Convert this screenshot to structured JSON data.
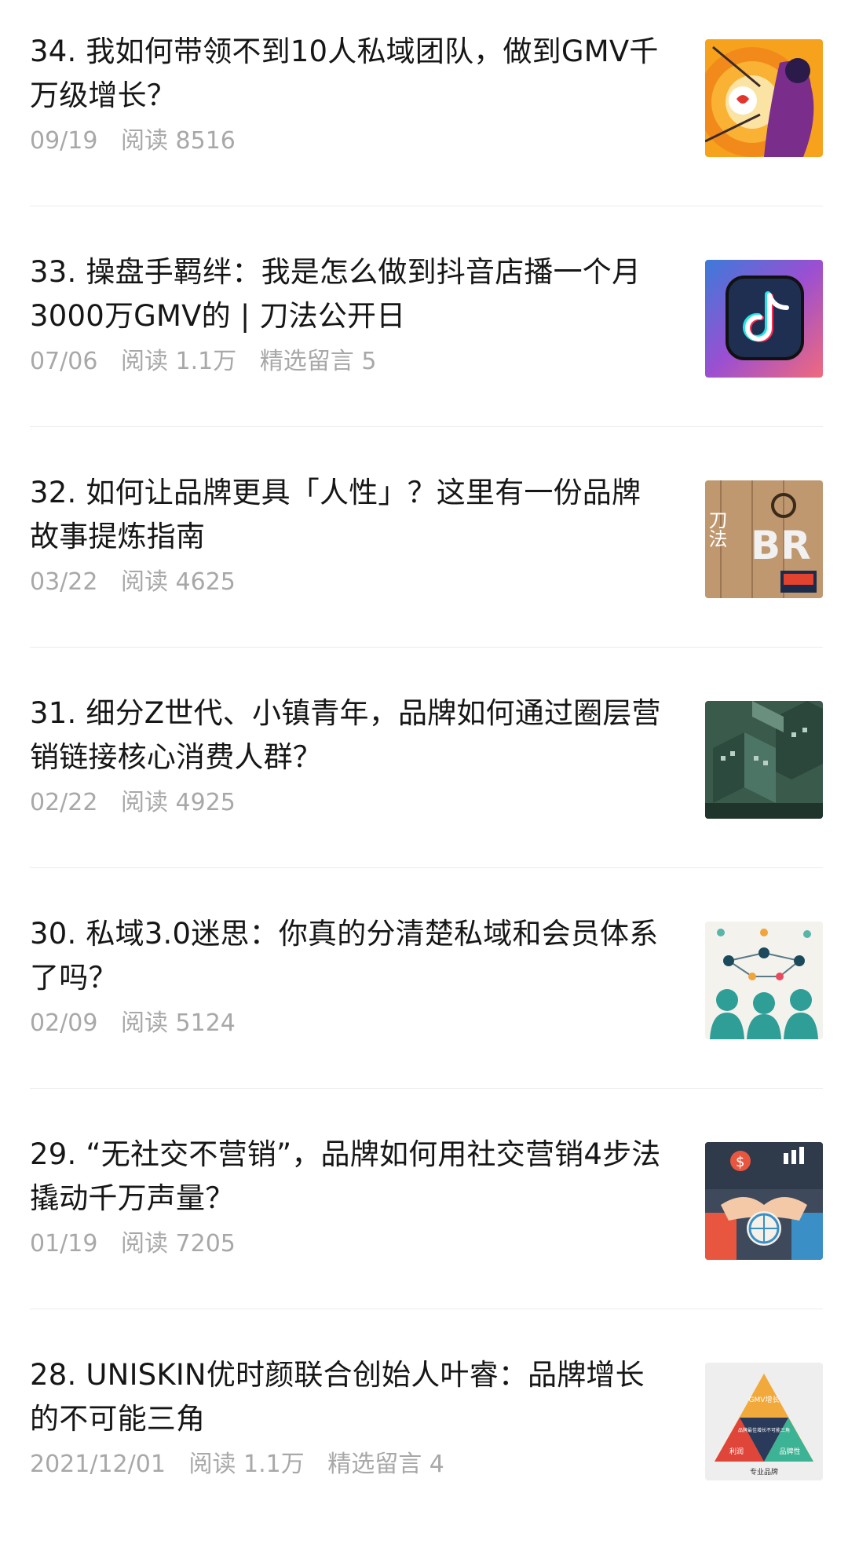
{
  "articles": [
    {
      "title": "34. 我如何带领不到10人私域团队，做到GMV千万级增长？",
      "date": "09/19",
      "reads": "阅读 8516",
      "comments": "",
      "thumb_icon": "target-illustration-icon"
    },
    {
      "title": "33. 操盘手羁绊：我是怎么做到抖音店播一个月3000万GMV的 | 刀法公开日",
      "date": "07/06",
      "reads": "阅读 1.1万",
      "comments": "精选留言 5",
      "thumb_icon": "tiktok-logo-icon"
    },
    {
      "title": "32. 如何让品牌更具「人性」？这里有一份品牌故事提炼指南",
      "date": "03/22",
      "reads": "阅读 4625",
      "comments": "",
      "thumb_icon": "brand-letters-icon"
    },
    {
      "title": "31. 细分Z世代、小镇青年，品牌如何通过圈层营销链接核心消费人群？",
      "date": "02/22",
      "reads": "阅读 4925",
      "comments": "",
      "thumb_icon": "isometric-city-icon"
    },
    {
      "title": "30. 私域3.0迷思：你真的分清楚私域和会员体系了吗？",
      "date": "02/09",
      "reads": "阅读 5124",
      "comments": "",
      "thumb_icon": "network-people-icon"
    },
    {
      "title": "29. “无社交不营销”，品牌如何用社交营销4步法撬动千万声量？",
      "date": "01/19",
      "reads": "阅读 7205",
      "comments": "",
      "thumb_icon": "handshake-globe-icon"
    },
    {
      "title": "28. UNISKIN优时颜联合创始人叶睿：品牌增长的不可能三角",
      "date": "2021/12/01",
      "reads": "阅读 1.1万",
      "comments": "精选留言 4",
      "thumb_icon": "triangle-diagram-icon"
    }
  ],
  "thumb_text": {
    "brand_letters": "刀法",
    "brand_caption": "BR",
    "triangle_top": "GMV增长",
    "triangle_center": "品牌最佳增长不可能三角",
    "triangle_left": "利润",
    "triangle_right": "品牌性",
    "triangle_bottom": "专业品牌"
  },
  "colors": {
    "title": "#161616",
    "meta": "#a8a8a8",
    "divider": "#ececec"
  }
}
